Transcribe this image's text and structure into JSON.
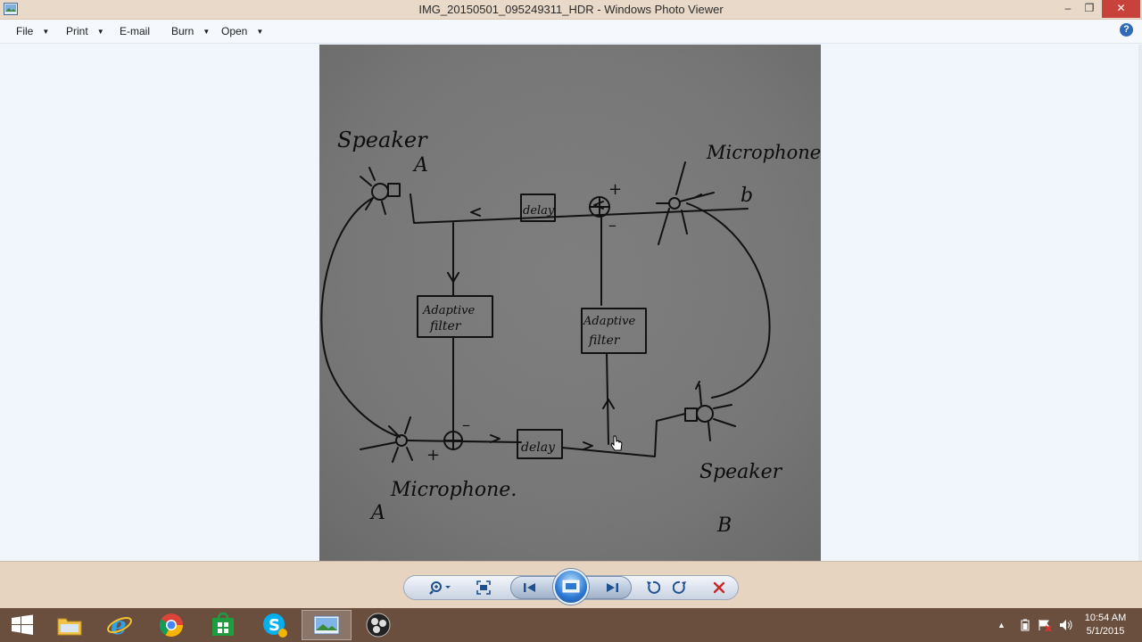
{
  "window": {
    "title": "IMG_20150501_095249311_HDR - Windows Photo Viewer",
    "buttons": {
      "minimize": "–",
      "maximize": "❐",
      "close": "✕"
    }
  },
  "menu": [
    {
      "label": "File",
      "has_dropdown": true
    },
    {
      "label": "Print",
      "has_dropdown": true
    },
    {
      "label": "E-mail",
      "has_dropdown": false
    },
    {
      "label": "Burn",
      "has_dropdown": true
    },
    {
      "label": "Open",
      "has_dropdown": true
    }
  ],
  "help": {
    "label": "?"
  },
  "photo": {
    "labels": {
      "speaker_a": "Speaker",
      "speaker_a_letter": "A",
      "microphone_b": "Microphone",
      "microphone_b_letter": "b",
      "microphone_a": "Microphone.",
      "microphone_a_letter": "A",
      "speaker_b": "Speaker",
      "speaker_b_letter": "B",
      "delay_top": "delay",
      "delay_bottom": "delay",
      "filter_left_line1": "Adaptive",
      "filter_left_line2": "filter",
      "filter_right_line1": "Adaptive",
      "filter_right_line2": "filter",
      "sum_top_plus": "+",
      "sum_top_minus": "–",
      "sum_bottom_plus": "+",
      "sum_bottom_minus": "–"
    }
  },
  "controls": {
    "zoom": "zoom-icon",
    "actual_size": "fit-window-icon",
    "previous": "previous-icon",
    "slideshow": "slideshow-icon",
    "next": "next-icon",
    "rotate_ccw": "rotate-counterclockwise-icon",
    "rotate_cw": "rotate-clockwise-icon",
    "delete": "delete-icon"
  },
  "taskbar": {
    "apps": [
      "start",
      "file-explorer",
      "internet-explorer",
      "chrome",
      "store",
      "skype",
      "photo-viewer",
      "obs"
    ],
    "clock_time": "10:54 AM",
    "clock_date": "5/1/2015"
  },
  "colors": {
    "titlebar": "#e9d9c8",
    "close_button": "#c7423b",
    "taskbar": "#6b4f3e",
    "accent": "#2c78d2"
  }
}
